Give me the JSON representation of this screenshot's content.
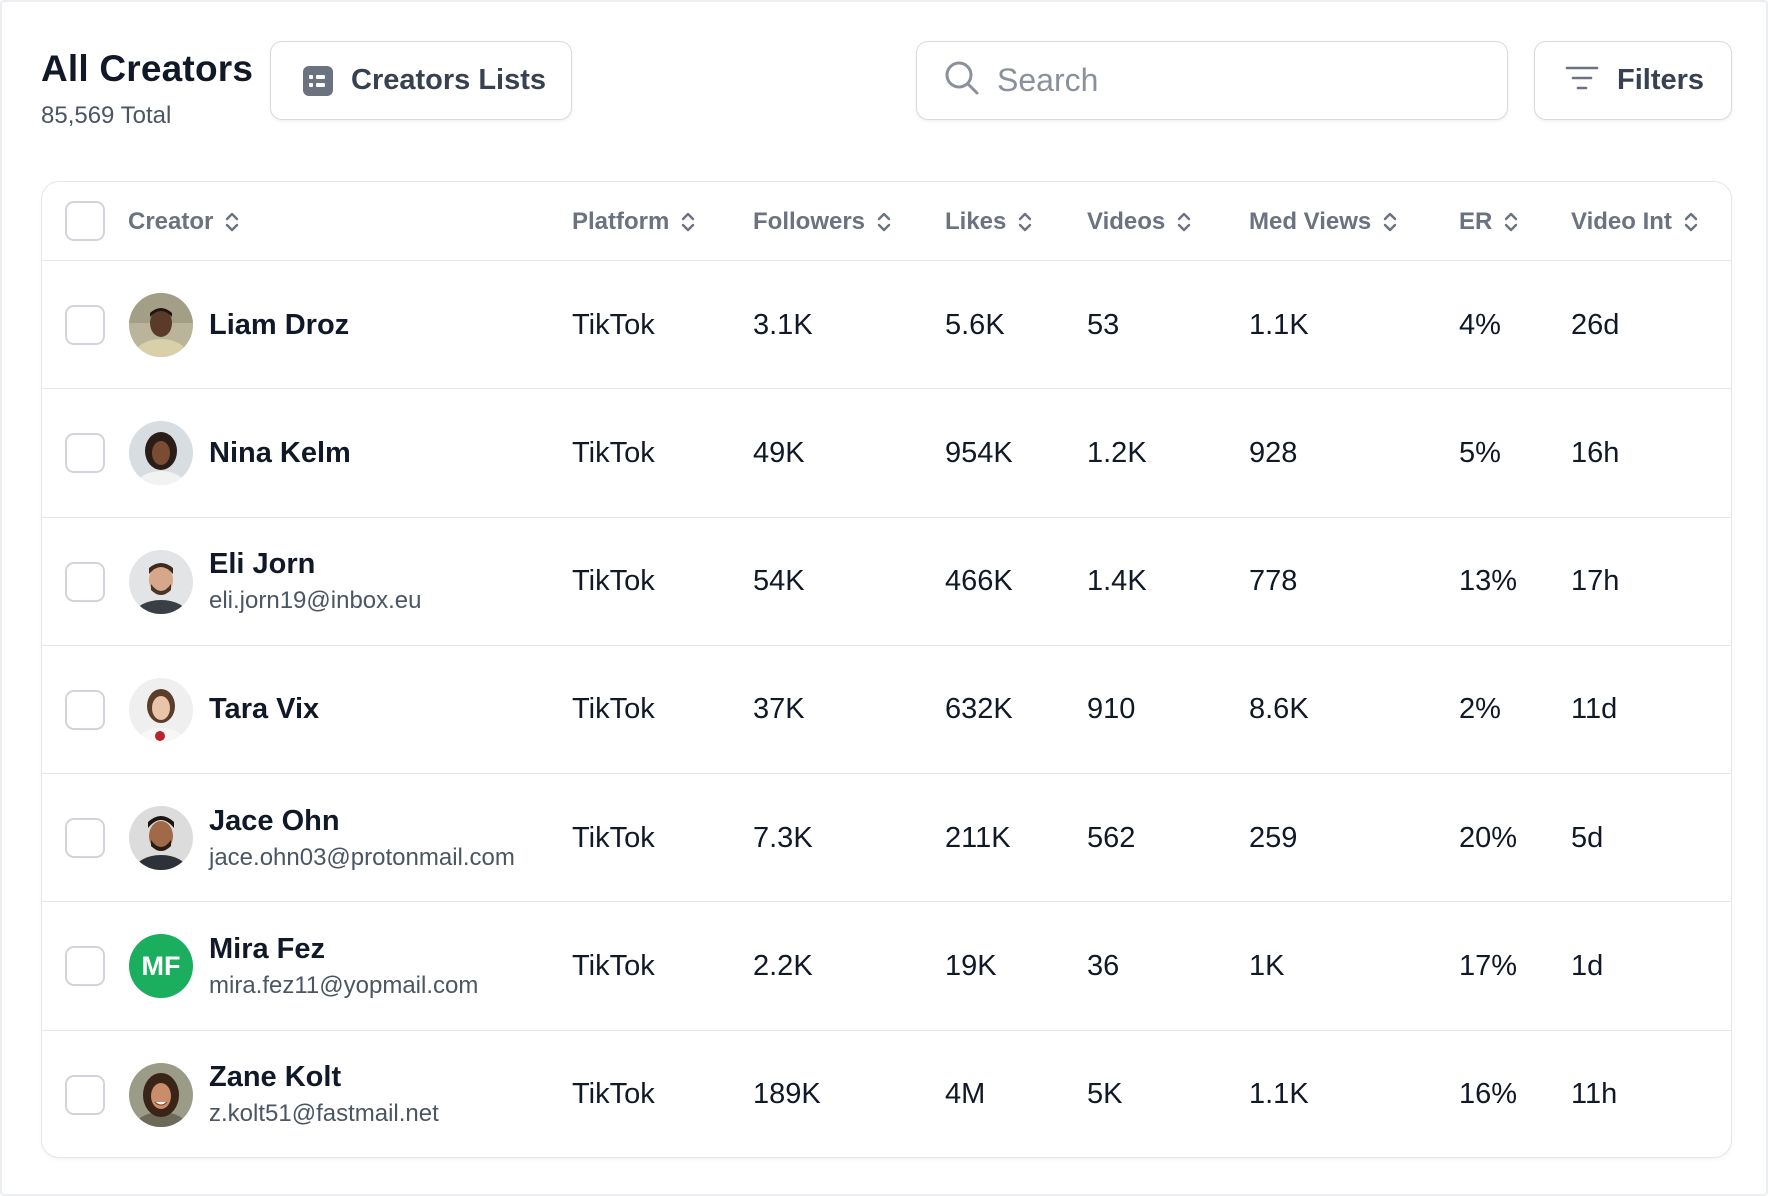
{
  "header": {
    "title": "All Creators",
    "total": "85,569 Total",
    "lists_button": "Creators Lists",
    "search_placeholder": "Search",
    "search_value": "",
    "filters_button": "Filters"
  },
  "table": {
    "columns": [
      "Creator",
      "Platform",
      "Followers",
      "Likes",
      "Videos",
      "Med Views",
      "ER",
      "Video Int"
    ],
    "rows": [
      {
        "name": "Liam Droz",
        "email": "",
        "avatar": "photo-avatar",
        "platform": "TikTok",
        "followers": "3.1K",
        "likes": "5.6K",
        "videos": "53",
        "med_views": "1.1K",
        "er": "4%",
        "video_int": "26d"
      },
      {
        "name": "Nina Kelm",
        "email": "",
        "avatar": "photo-avatar",
        "platform": "TikTok",
        "followers": "49K",
        "likes": "954K",
        "videos": "1.2K",
        "med_views": "928",
        "er": "5%",
        "video_int": "16h"
      },
      {
        "name": "Eli Jorn",
        "email": "eli.jorn19@inbox.eu",
        "avatar": "photo-avatar",
        "platform": "TikTok",
        "followers": "54K",
        "likes": "466K",
        "videos": "1.4K",
        "med_views": "778",
        "er": "13%",
        "video_int": "17h"
      },
      {
        "name": "Tara Vix",
        "email": "",
        "avatar": "photo-avatar",
        "platform": "TikTok",
        "followers": "37K",
        "likes": "632K",
        "videos": "910",
        "med_views": "8.6K",
        "er": "2%",
        "video_int": "11d"
      },
      {
        "name": "Jace Ohn",
        "email": "jace.ohn03@protonmail.com",
        "avatar": "photo-avatar",
        "platform": "TikTok",
        "followers": "7.3K",
        "likes": "211K",
        "videos": "562",
        "med_views": "259",
        "er": "20%",
        "video_int": "5d"
      },
      {
        "name": "Mira Fez",
        "email": "mira.fez11@yopmail.com",
        "avatar": "initials",
        "initials": "MF",
        "platform": "TikTok",
        "followers": "2.2K",
        "likes": "19K",
        "videos": "36",
        "med_views": "1K",
        "er": "17%",
        "video_int": "1d"
      },
      {
        "name": "Zane Kolt",
        "email": "z.kolt51@fastmail.net",
        "avatar": "photo-avatar",
        "platform": "TikTok",
        "followers": "189K",
        "likes": "4M",
        "videos": "5K",
        "med_views": "1.1K",
        "er": "16%",
        "video_int": "11h"
      }
    ]
  },
  "colors": {
    "initials_avatar_bg": "#1aae5e",
    "border": "#e4e7eb",
    "muted_text": "#6b7280"
  },
  "icons": [
    "list-icon",
    "search-icon",
    "filter-icon",
    "sort-icon",
    "checkbox"
  ]
}
